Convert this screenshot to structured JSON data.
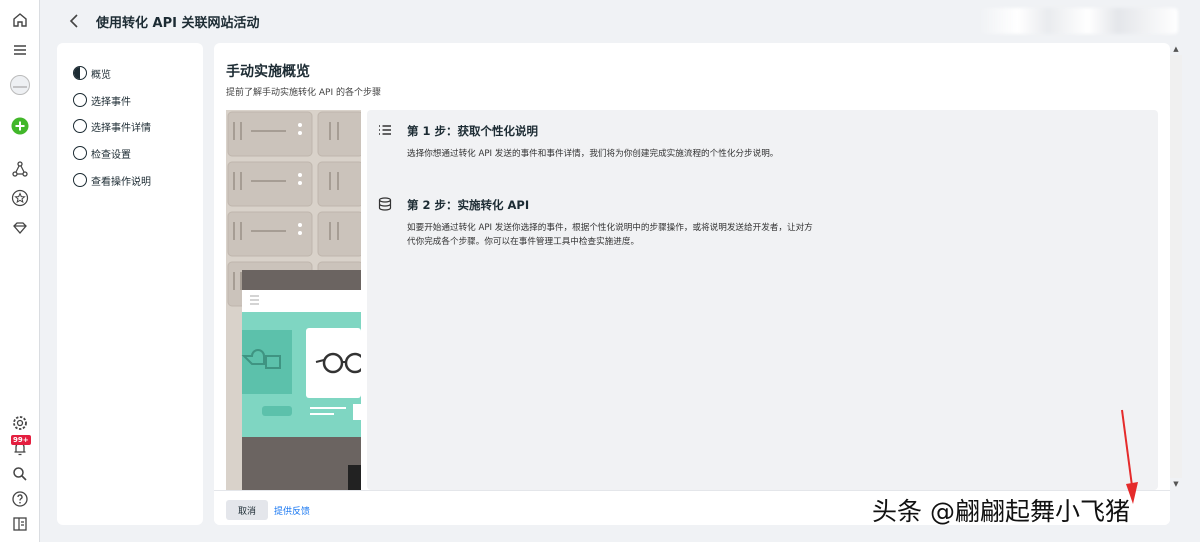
{
  "header": {
    "title": "使用转化 API 关联网站活动"
  },
  "steps_nav": {
    "items": [
      {
        "label": "概览",
        "state": "current"
      },
      {
        "label": "选择事件",
        "state": "todo"
      },
      {
        "label": "选择事件详情",
        "state": "todo"
      },
      {
        "label": "检查设置",
        "state": "todo"
      },
      {
        "label": "查看操作说明",
        "state": "todo"
      }
    ]
  },
  "main": {
    "title": "手动实施概览",
    "subtitle": "提前了解手动实施转化 API 的各个步骤",
    "steps": [
      {
        "icon": "list-icon",
        "title": "第 1 步：获取个性化说明",
        "desc": "选择你想通过转化 API 发送的事件和事件详情，我们将为你创建完成实施流程的个性化分步说明。"
      },
      {
        "icon": "database-icon",
        "title": "第 2 步：实施转化 API",
        "desc": "如要开始通过转化 API 发送你选择的事件，根据个性化说明中的步骤操作，或将说明发送给开发者，让对方代你完成各个步骤。你可以在事件管理工具中检查实施进度。"
      }
    ]
  },
  "footer": {
    "cancel": "取消",
    "feedback": "提供反馈"
  },
  "rail": {
    "notification_badge": "99+"
  },
  "watermark": "头条 @翩翩起舞小飞猪",
  "colors": {
    "accent": "#1877f2",
    "badge": "#e41e3f",
    "add": "#42b72a",
    "illustration_teal": "#7fd6c2"
  }
}
